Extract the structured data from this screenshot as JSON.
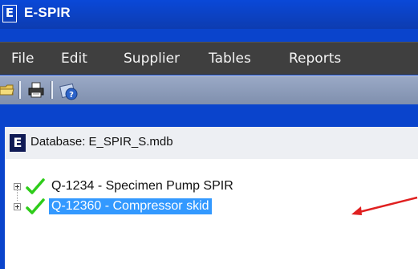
{
  "window": {
    "title": "E-SPIR",
    "app_icon_letter": "E"
  },
  "menu": {
    "items": [
      "File",
      "Edit",
      "Supplier",
      "Tables",
      "Reports"
    ]
  },
  "toolbar": {
    "buttons": [
      "open-folder-icon",
      "print-icon",
      "help-icon"
    ]
  },
  "child_window": {
    "icon_letter": "E",
    "title": "Database: E_SPIR_S.mdb"
  },
  "tree": {
    "items": [
      {
        "label": "Q-1234 - Specimen Pump SPIR",
        "status": "check-icon",
        "selected": false
      },
      {
        "label": "Q-12360 - Compressor skid",
        "status": "check-icon",
        "selected": true
      }
    ]
  },
  "colors": {
    "frame": "#0a44cc",
    "menubar": "#3f3f3f",
    "selection": "#3399ff",
    "check": "#2ecc1a",
    "annotation_arrow": "#e02020"
  }
}
